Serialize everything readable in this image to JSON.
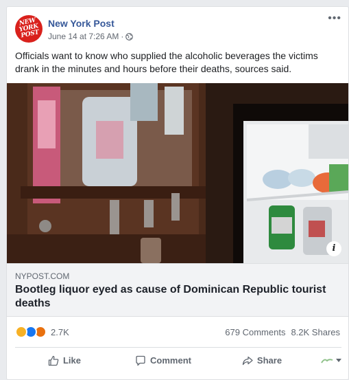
{
  "post": {
    "page_name": "New York Post",
    "logo_text_1": "NEW",
    "logo_text_2": "YORK",
    "logo_text_3": "POST",
    "timestamp": "June 14 at 7:26 AM",
    "separator": "·",
    "privacy_icon": "globe-icon",
    "more_icon": "•••",
    "message": "Officials want to know who supplied the alcoholic beverages the victims drank in the minutes and hours before their deaths, sources said."
  },
  "link": {
    "domain": "NYPOST.COM",
    "headline": "Bootleg liquor eyed as cause of Dominican Republic tourist deaths",
    "info_icon": "i"
  },
  "stats": {
    "reaction_icons": [
      "wow-icon",
      "like-icon",
      "angry-icon"
    ],
    "reaction_count": "2.7K",
    "comments": "679 Comments",
    "shares": "8.2K Shares"
  },
  "actions": {
    "like": "Like",
    "comment": "Comment",
    "share": "Share"
  },
  "colors": {
    "brand_blue": "#365899",
    "nypost_red": "#d9211c",
    "like_blue": "#1877f2"
  }
}
